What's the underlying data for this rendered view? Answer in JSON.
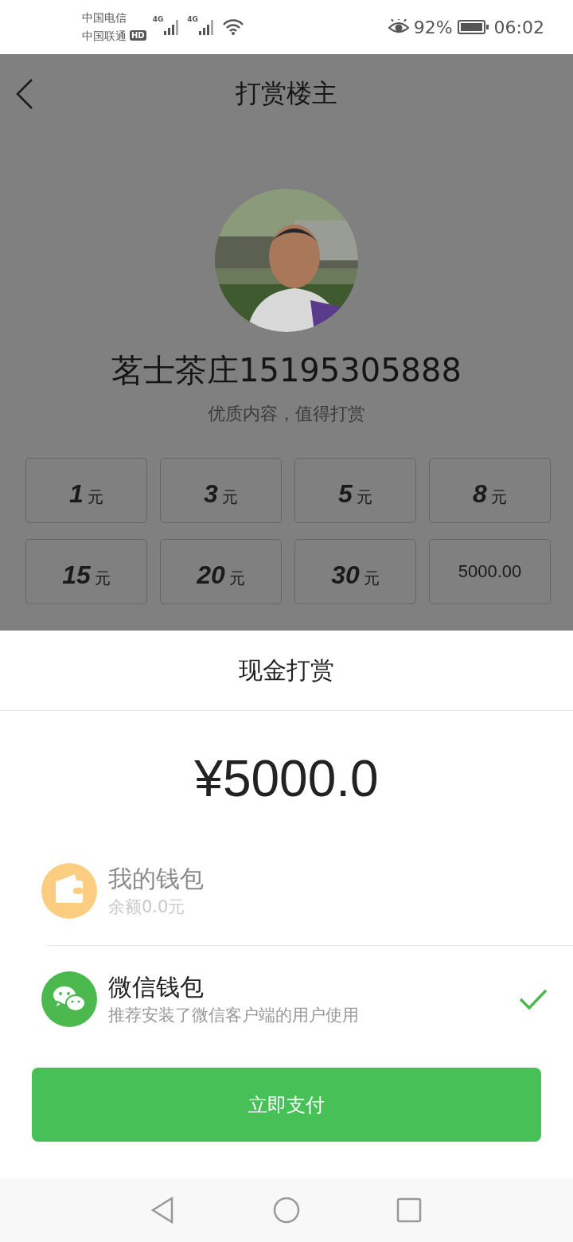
{
  "status_bar": {
    "carriers": [
      "中国电信",
      "中国联通"
    ],
    "hd_badge": "HD",
    "network_labels": [
      "4G",
      "4G"
    ],
    "battery_percent": "92%",
    "time": "06:02"
  },
  "header": {
    "title": "打赏楼主"
  },
  "profile": {
    "name": "茗士茶庄15195305888",
    "subtitle": "优质内容，值得打赏"
  },
  "amounts": [
    {
      "kind": "preset",
      "value": "1",
      "unit": "元"
    },
    {
      "kind": "preset",
      "value": "3",
      "unit": "元"
    },
    {
      "kind": "preset",
      "value": "5",
      "unit": "元"
    },
    {
      "kind": "preset",
      "value": "8",
      "unit": "元"
    },
    {
      "kind": "preset",
      "value": "15",
      "unit": "元"
    },
    {
      "kind": "preset",
      "value": "20",
      "unit": "元"
    },
    {
      "kind": "preset",
      "value": "30",
      "unit": "元"
    },
    {
      "kind": "custom",
      "value": "5000.00"
    }
  ],
  "payment_sheet": {
    "title": "现金打赏",
    "amount": "¥5000.0",
    "methods": [
      {
        "kind": "wallet",
        "name": "我的钱包",
        "note": "余额0.0元",
        "disabled": true,
        "selected": false
      },
      {
        "kind": "wechat",
        "name": "微信钱包",
        "note": "推荐安装了微信客户端的用户使用",
        "disabled": false,
        "selected": true
      }
    ],
    "pay_button": "立即支付"
  }
}
